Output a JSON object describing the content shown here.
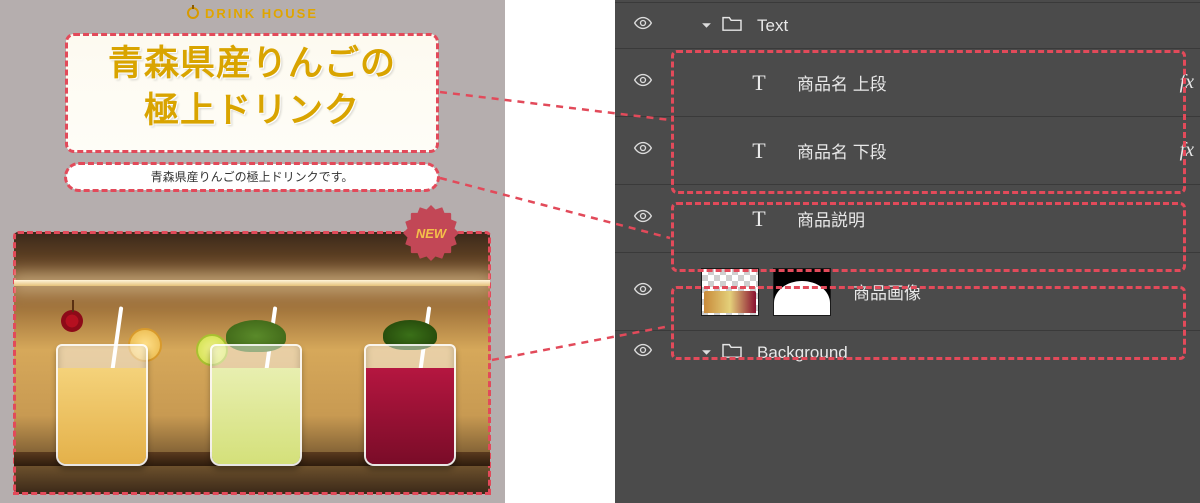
{
  "preview": {
    "brand_logo_text": "DRINK HOUSE",
    "title_line1": "青森県産りんごの",
    "title_line2": "極上ドリンク",
    "description": "青森県産りんごの極上ドリンクです。",
    "new_badge": "NEW"
  },
  "panel": {
    "group_text_label": "Text",
    "layers": [
      {
        "name": "商品名 上段",
        "has_fx": true
      },
      {
        "name": "商品名 下段",
        "has_fx": true
      },
      {
        "name": "商品説明",
        "has_fx": false
      }
    ],
    "image_layer_label": "商品画像",
    "group_bg_label": "Background",
    "fx_label": "fx"
  }
}
